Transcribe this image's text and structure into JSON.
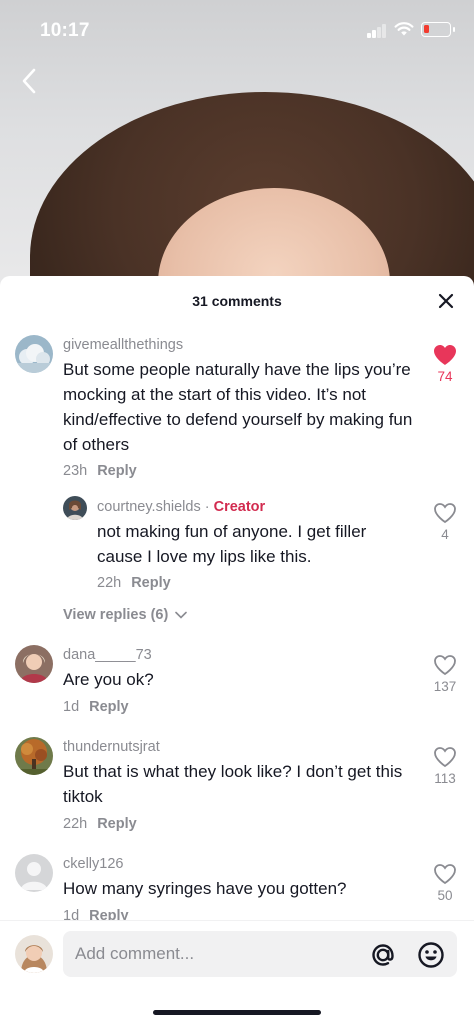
{
  "status_bar": {
    "time": "10:17"
  },
  "sheet": {
    "count_label": "31 comments"
  },
  "comments": [
    {
      "username": "givemeallthethings",
      "text": "But some people naturally have the lips you’re mocking at the start of this video. It’s not kind/effective to defend yourself by making fun of others",
      "time": "23h",
      "reply_label": "Reply",
      "likes": "74",
      "liked": true,
      "replies": [
        {
          "username": "courtney.shields",
          "separator": "·",
          "badge": "Creator",
          "text": "not making fun of anyone. I get filler cause I love my lips like this.",
          "time": "22h",
          "reply_label": "Reply",
          "likes": "4"
        }
      ],
      "view_replies_label": "View replies (6)"
    },
    {
      "username": "dana_____73",
      "text": "Are you ok?",
      "time": "1d",
      "reply_label": "Reply",
      "likes": "137"
    },
    {
      "username": "thundernutsjrat",
      "text": "But that is what they look like? I don’t get this tiktok",
      "time": "22h",
      "reply_label": "Reply",
      "likes": "113"
    },
    {
      "username": "ckelly126",
      "text": "How many syringes have you gotten?",
      "time": "1d",
      "reply_label": "Reply",
      "likes": "50"
    }
  ],
  "input": {
    "placeholder": "Add comment..."
  },
  "colors": {
    "like_active": "#e8365a",
    "creator_badge": "#d22b4f",
    "secondary_text": "#8a8b91"
  }
}
